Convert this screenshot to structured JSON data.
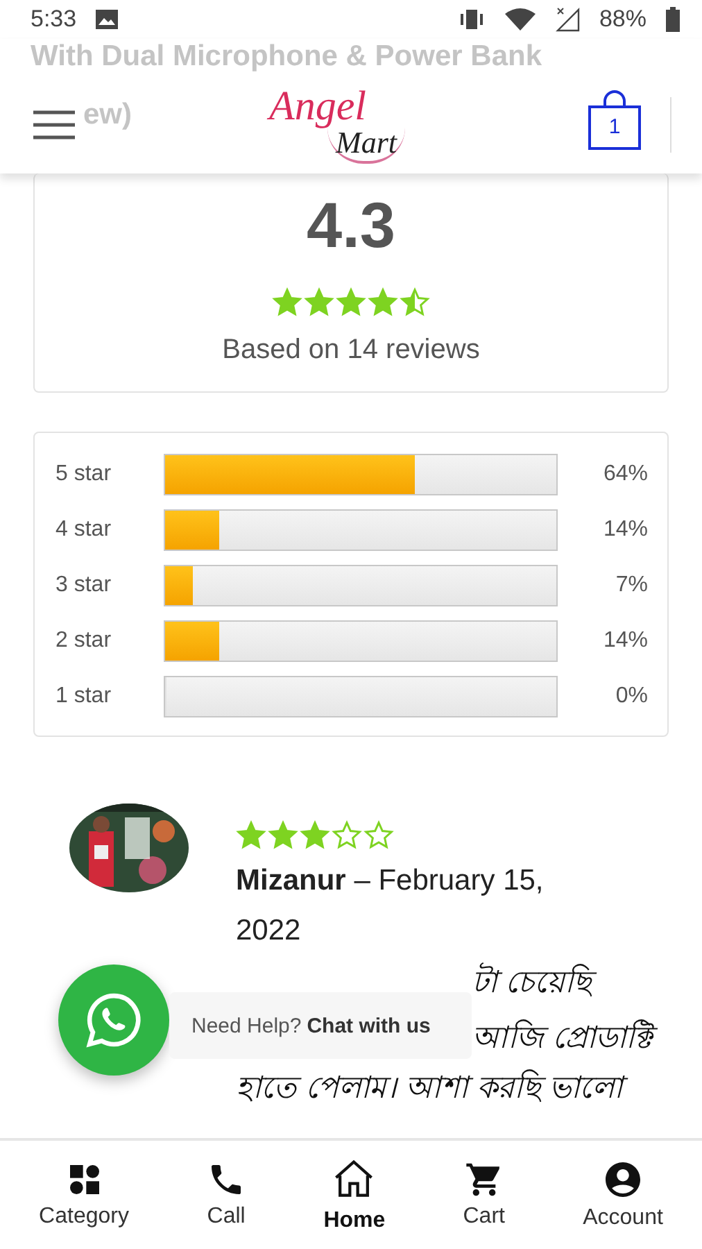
{
  "status_bar": {
    "time": "5:33",
    "battery": "88%"
  },
  "behind_header": [
    "With Dual Microphone & Power Bank",
    "ew)"
  ],
  "header": {
    "logo_top": "Angel",
    "logo_bottom": "Mart",
    "cart_count": "1"
  },
  "summary": {
    "average": "4.3",
    "stars": 4.5,
    "caption": "Based on 14 reviews"
  },
  "breakdown": [
    {
      "label": "5 star",
      "level": 0.64,
      "percent": "64%"
    },
    {
      "label": "4 star",
      "level": 0.14,
      "percent": "14%"
    },
    {
      "label": "3 star",
      "level": 0.07,
      "percent": "7%"
    },
    {
      "label": "2 star",
      "level": 0.14,
      "percent": "14%"
    },
    {
      "label": "1 star",
      "level": 0,
      "percent": "0%"
    }
  ],
  "review": {
    "stars": 3,
    "author": "Mizanur",
    "date": "– February 15, 2022",
    "body_visible": [
      {
        "text": "টা চেয়েছি",
        "kind": "partial"
      },
      {
        "text": "আজি প্রোডাক্টি",
        "kind": "partial"
      },
      {
        "text": "হাতে পেলাম। আশা করছি ভালো",
        "kind": "full"
      }
    ]
  },
  "chat": {
    "prompt": "Need Help?",
    "action": "Chat with us"
  },
  "bottom_nav": [
    {
      "label": "Category",
      "selected": false
    },
    {
      "label": "Call",
      "selected": false
    },
    {
      "label": "Home",
      "selected": true
    },
    {
      "label": "Cart",
      "selected": false
    },
    {
      "label": "Account",
      "selected": false
    }
  ]
}
